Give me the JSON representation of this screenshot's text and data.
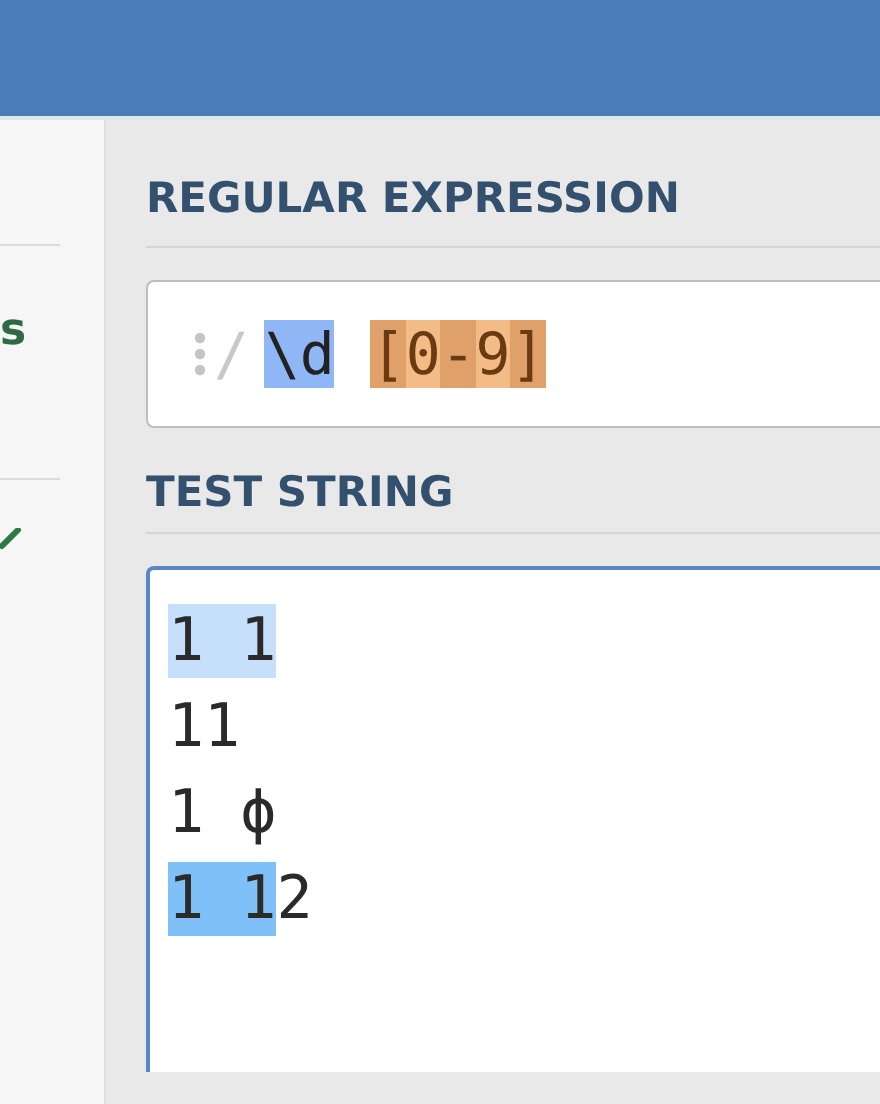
{
  "sidebar": {
    "items": [
      {
        "kind": "text",
        "label": "s"
      },
      {
        "kind": "check"
      }
    ]
  },
  "regex": {
    "title": "REGULAR EXPRESSION",
    "delimiter": "/",
    "groups": [
      [
        {
          "text": "\\d",
          "kind": "escape"
        }
      ],
      [
        {
          "text": "[",
          "kind": "class-edge"
        },
        {
          "text": "0",
          "kind": "class-item"
        },
        {
          "text": "-",
          "kind": "class-edge"
        },
        {
          "text": "9",
          "kind": "class-item"
        },
        {
          "text": "]",
          "kind": "class-edge"
        }
      ]
    ]
  },
  "test_string": {
    "title": "TEST STRING",
    "lines": [
      [
        {
          "text": "1 1",
          "kind": "match"
        }
      ],
      [
        {
          "text": "11",
          "kind": "plain"
        }
      ],
      [
        {
          "text": "1 ϕ",
          "kind": "plain"
        }
      ],
      [
        {
          "text": "1 1",
          "kind": "match-alt"
        },
        {
          "text": "2",
          "kind": "plain"
        }
      ]
    ]
  }
}
